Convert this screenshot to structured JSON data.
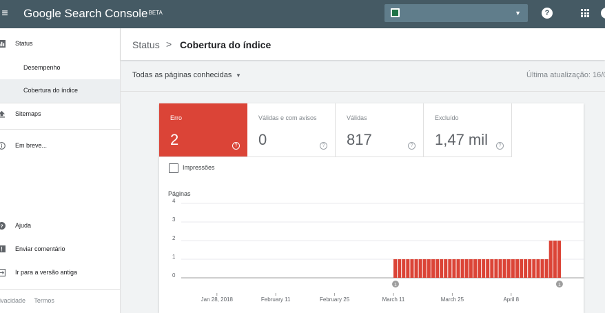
{
  "topbar": {
    "brand": "Google Search Console",
    "badge": "BETA"
  },
  "sidebar": {
    "items": [
      {
        "label": "Status",
        "icon": "bar-chart-icon"
      },
      {
        "label": "Desempenho"
      },
      {
        "label": "Cobertura do índice",
        "active": true
      },
      {
        "label": "Sitemaps",
        "icon": "upload-icon"
      },
      {
        "label": "Em breve...",
        "icon": "info-icon"
      },
      {
        "label": "Ajuda",
        "icon": "help-icon"
      },
      {
        "label": "Enviar comentário",
        "icon": "feedback-icon"
      },
      {
        "label": "Ir para a versão antiga",
        "icon": "exit-icon"
      }
    ],
    "footer": [
      "rivacidade",
      "Termos"
    ]
  },
  "breadcrumb": {
    "parent": "Status",
    "separator": ">",
    "current": "Cobertura do índice"
  },
  "filter": {
    "selected": "Todas as páginas conhecidas",
    "last_updated": "Última atualização: 16/0"
  },
  "tiles": [
    {
      "label": "Erro",
      "value": "2",
      "color": "#db4437"
    },
    {
      "label": "Válidas e com avisos",
      "value": "0"
    },
    {
      "label": "Válidas",
      "value": "817"
    },
    {
      "label": "Excluído",
      "value": "1,47 mil"
    }
  ],
  "impressions_label": "Impressões",
  "chart_data": {
    "type": "bar",
    "ylabel": "Páginas",
    "ylim": [
      0,
      4
    ],
    "yticks": [
      "0",
      "1",
      "2",
      "3",
      "4"
    ],
    "xtick_labels": [
      "Jan 28, 2018",
      "February 11",
      "February 25",
      "March 11",
      "March 25",
      "April 8"
    ],
    "start_date": "2018-01-20",
    "days": 90,
    "xtick_day_index": [
      8,
      22,
      36,
      50,
      64,
      78
    ],
    "values": [
      0,
      0,
      0,
      0,
      0,
      0,
      0,
      0,
      0,
      0,
      0,
      0,
      0,
      0,
      0,
      0,
      0,
      0,
      0,
      0,
      0,
      0,
      0,
      0,
      0,
      0,
      0,
      0,
      0,
      0,
      0,
      0,
      0,
      0,
      0,
      0,
      0,
      0,
      0,
      0,
      0,
      0,
      0,
      0,
      0,
      0,
      0,
      0,
      0,
      0,
      1,
      1,
      1,
      1,
      1,
      1,
      1,
      1,
      1,
      1,
      1,
      1,
      1,
      1,
      1,
      1,
      1,
      1,
      1,
      1,
      1,
      1,
      1,
      1,
      1,
      1,
      1,
      1,
      1,
      1,
      1,
      1,
      1,
      1,
      1,
      1,
      1,
      2,
      2,
      2
    ],
    "annotations": [
      {
        "day_index": 50,
        "label": "1"
      },
      {
        "day_index": 89,
        "label": "1"
      }
    ],
    "bar_color": "#db4437"
  }
}
